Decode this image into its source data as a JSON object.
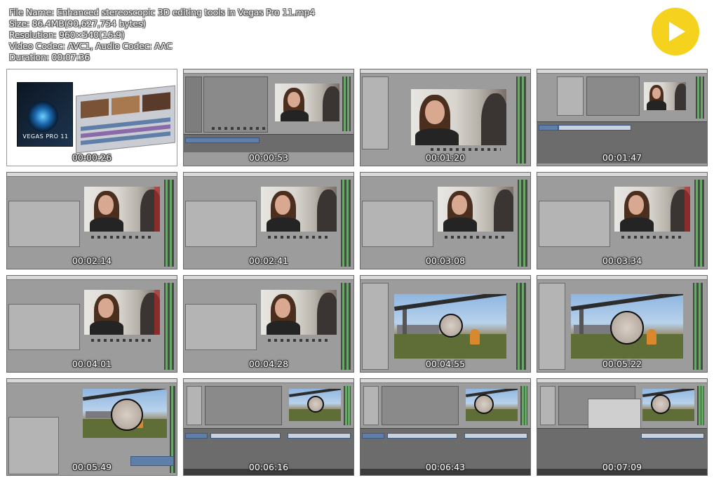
{
  "header": {
    "file_name": "File Name: Enhanced stereoscopic 3D editing tools in Vegas Pro 11.mp4",
    "size": "Size: 86.4MB(90,627,754 bytes)",
    "resolution": "Resolution: 960×540(16:9)",
    "codec": "Video Codec: AVC1, Audio Codec: AAC",
    "duration": "Duration: 00:07:36"
  },
  "play_button": {
    "icon": "play-icon",
    "color": "#f4d21d"
  },
  "box_art": {
    "title": "VEGAS PRO 11"
  },
  "thumbnails": [
    {
      "time": "00:00:26",
      "scene": "box"
    },
    {
      "time": "00:00:53",
      "scene": "woman"
    },
    {
      "time": "00:01:20",
      "scene": "woman"
    },
    {
      "time": "00:01:47",
      "scene": "woman"
    },
    {
      "time": "00:02:14",
      "scene": "woman"
    },
    {
      "time": "00:02:41",
      "scene": "woman"
    },
    {
      "time": "00:03:08",
      "scene": "woman"
    },
    {
      "time": "00:03:34",
      "scene": "woman"
    },
    {
      "time": "00:04:01",
      "scene": "woman"
    },
    {
      "time": "00:04:28",
      "scene": "woman"
    },
    {
      "time": "00:04:55",
      "scene": "bridge"
    },
    {
      "time": "00:05:22",
      "scene": "bridge"
    },
    {
      "time": "00:05:49",
      "scene": "bridge"
    },
    {
      "time": "00:06:16",
      "scene": "bridge"
    },
    {
      "time": "00:06:43",
      "scene": "bridge"
    },
    {
      "time": "00:07:09",
      "scene": "bridge"
    }
  ]
}
